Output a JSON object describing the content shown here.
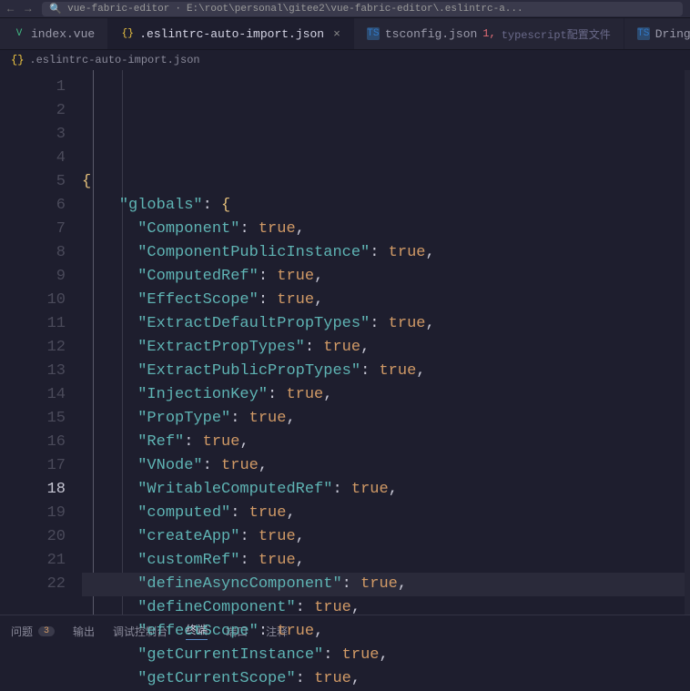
{
  "titlebar": {
    "search_prefix": "vue-fabric-editor",
    "search_path": "E:\\root\\personal\\gitee2\\vue-fabric-editor\\.eslintrc-a..."
  },
  "tabs": [
    {
      "icon": "vue",
      "label": "index.vue",
      "active": false,
      "error": "",
      "info": ""
    },
    {
      "icon": "json",
      "label": ".eslintrc-auto-import.json",
      "active": true,
      "error": "",
      "info": "",
      "close": true
    },
    {
      "icon": "ts",
      "label": "tsconfig.json",
      "active": false,
      "error": "1",
      "info": "typescript配置文件"
    },
    {
      "icon": "ts",
      "label": "DringPlugin.ts",
      "active": false,
      "error": "",
      "info": ""
    },
    {
      "icon": "vue",
      "label": "",
      "active": false,
      "error": "",
      "info": ""
    }
  ],
  "breadcrumb": {
    "icon": "json",
    "file": ".eslintrc-auto-import.json"
  },
  "code": {
    "lines": [
      {
        "n": 1,
        "indent": 0,
        "type": "open",
        "text": "{"
      },
      {
        "n": 2,
        "indent": 1,
        "type": "objkey",
        "key": "globals",
        "open": true
      },
      {
        "n": 3,
        "indent": 2,
        "type": "kv",
        "key": "Component",
        "val": "true"
      },
      {
        "n": 4,
        "indent": 2,
        "type": "kv",
        "key": "ComponentPublicInstance",
        "val": "true"
      },
      {
        "n": 5,
        "indent": 2,
        "type": "kv",
        "key": "ComputedRef",
        "val": "true"
      },
      {
        "n": 6,
        "indent": 2,
        "type": "kv",
        "key": "EffectScope",
        "val": "true"
      },
      {
        "n": 7,
        "indent": 2,
        "type": "kv",
        "key": "ExtractDefaultPropTypes",
        "val": "true"
      },
      {
        "n": 8,
        "indent": 2,
        "type": "kv",
        "key": "ExtractPropTypes",
        "val": "true"
      },
      {
        "n": 9,
        "indent": 2,
        "type": "kv",
        "key": "ExtractPublicPropTypes",
        "val": "true"
      },
      {
        "n": 10,
        "indent": 2,
        "type": "kv",
        "key": "InjectionKey",
        "val": "true"
      },
      {
        "n": 11,
        "indent": 2,
        "type": "kv",
        "key": "PropType",
        "val": "true"
      },
      {
        "n": 12,
        "indent": 2,
        "type": "kv",
        "key": "Ref",
        "val": "true"
      },
      {
        "n": 13,
        "indent": 2,
        "type": "kv",
        "key": "VNode",
        "val": "true"
      },
      {
        "n": 14,
        "indent": 2,
        "type": "kv",
        "key": "WritableComputedRef",
        "val": "true"
      },
      {
        "n": 15,
        "indent": 2,
        "type": "kv",
        "key": "computed",
        "val": "true"
      },
      {
        "n": 16,
        "indent": 2,
        "type": "kv",
        "key": "createApp",
        "val": "true"
      },
      {
        "n": 17,
        "indent": 2,
        "type": "kv",
        "key": "customRef",
        "val": "true"
      },
      {
        "n": 18,
        "indent": 2,
        "type": "kv",
        "key": "defineAsyncComponent",
        "val": "true",
        "current": true
      },
      {
        "n": 19,
        "indent": 2,
        "type": "kv",
        "key": "defineComponent",
        "val": "true"
      },
      {
        "n": 20,
        "indent": 2,
        "type": "kv",
        "key": "effectScope",
        "val": "true"
      },
      {
        "n": 21,
        "indent": 2,
        "type": "kv",
        "key": "getCurrentInstance",
        "val": "true"
      },
      {
        "n": 22,
        "indent": 2,
        "type": "kv",
        "key": "getCurrentScope",
        "val": "true"
      }
    ]
  },
  "panel": {
    "problems_label": "问题",
    "problems_count": "3",
    "output_label": "输出",
    "debug_label": "调试控制台",
    "terminal_label": "终端",
    "ports_label": "端口",
    "comments_label": "注释"
  }
}
